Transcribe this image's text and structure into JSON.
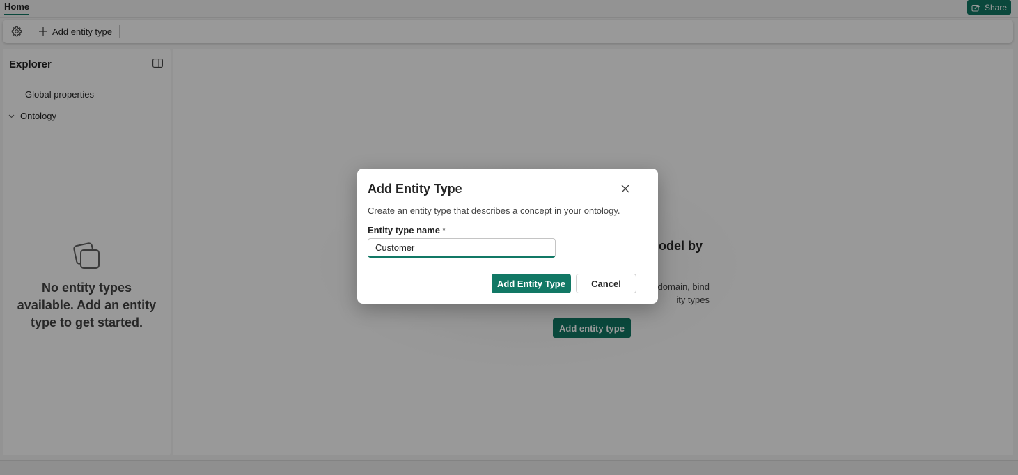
{
  "topbar": {
    "home_tab": "Home",
    "share_label": "Share"
  },
  "toolbar": {
    "settings_icon": "gear-icon",
    "add_entity_label": "Add entity type"
  },
  "explorer": {
    "title": "Explorer",
    "items": [
      {
        "label": "Global properties"
      },
      {
        "label": "Ontology"
      }
    ],
    "empty_message": "No entity types available. Add an entity type to get started."
  },
  "main": {
    "heading_fragment": "odel by",
    "desc_line1": "domain, bind",
    "desc_line2": "ity types",
    "add_button": "Add entity type"
  },
  "dialog": {
    "title": "Add Entity Type",
    "description": "Create an entity type that describes a concept in your ontology.",
    "field_label": "Entity type name",
    "required_marker": "*",
    "input_value": "Customer",
    "primary_button": "Add Entity Type",
    "secondary_button": "Cancel"
  },
  "colors": {
    "accent": "#117865",
    "overlay": "rgba(0,0,0,0.4)"
  }
}
